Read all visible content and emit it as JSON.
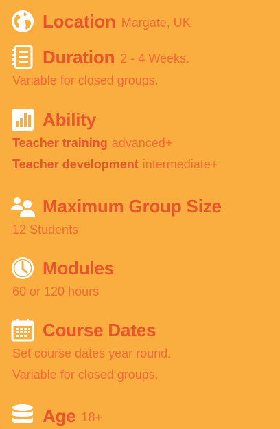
{
  "sections": {
    "location": {
      "title": "Location",
      "value": "Margate, UK",
      "icon": "globe-icon"
    },
    "duration": {
      "title": "Duration",
      "value": "2 - 4 Weeks.",
      "note": "Variable for closed groups.",
      "icon": "document-list-icon"
    },
    "ability": {
      "title": "Ability",
      "icon": "bar-chart-icon",
      "rows": [
        {
          "label": "Teacher training",
          "value": "advanced+"
        },
        {
          "label": "Teacher development",
          "value": "intermediate+"
        }
      ]
    },
    "group_size": {
      "title": "Maximum Group Size",
      "value": "12 Students",
      "icon": "users-icon"
    },
    "modules": {
      "title": "Modules",
      "value": "60 or 120 hours",
      "icon": "clock-icon"
    },
    "course_dates": {
      "title": "Course Dates",
      "lines": [
        "Set course dates year round.",
        "Variable for closed groups."
      ],
      "icon": "calendar-icon"
    },
    "age": {
      "title": "Age",
      "value": "18+",
      "icon": "database-icon"
    }
  },
  "colors": {
    "background": "#FBAE40",
    "heading": "#E8552C",
    "text": "#F26A35",
    "icon": "#FFFFFF"
  }
}
